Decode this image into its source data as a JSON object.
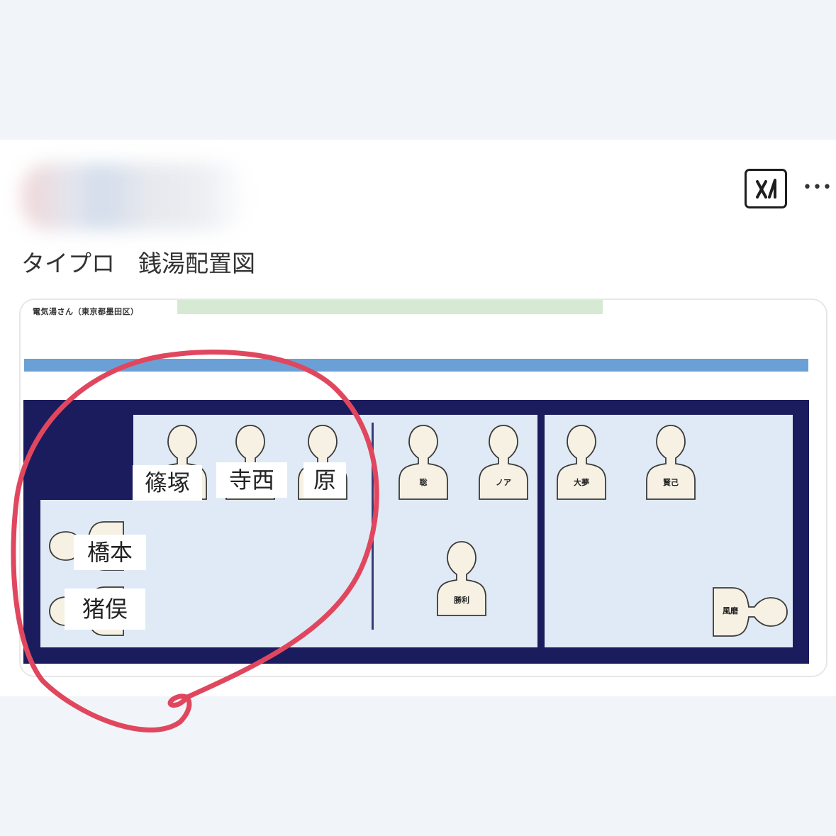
{
  "post": {
    "title": "タイプロ　銭湯配置図",
    "ai_icon": "ai-generated-icon",
    "more_icon": "more-options-icon"
  },
  "image": {
    "caption": "電気湯さん（東京都墨田区）",
    "people": [
      {
        "label": "聡"
      },
      {
        "label": "ノア"
      },
      {
        "label": "大夢"
      },
      {
        "label": "賢己"
      },
      {
        "label": "勝利"
      },
      {
        "label": "風磨"
      }
    ],
    "name_tags": [
      {
        "text": "篠塚"
      },
      {
        "text": "寺西"
      },
      {
        "text": "原"
      },
      {
        "text": "橋本"
      },
      {
        "text": "猪俣"
      }
    ]
  },
  "colors": {
    "annotation": "#e0475e",
    "floor": "#1b1c5e",
    "room": "#dfeaf6",
    "accent_bar": "#6aa0d6",
    "green_bar": "#d6ead3"
  }
}
